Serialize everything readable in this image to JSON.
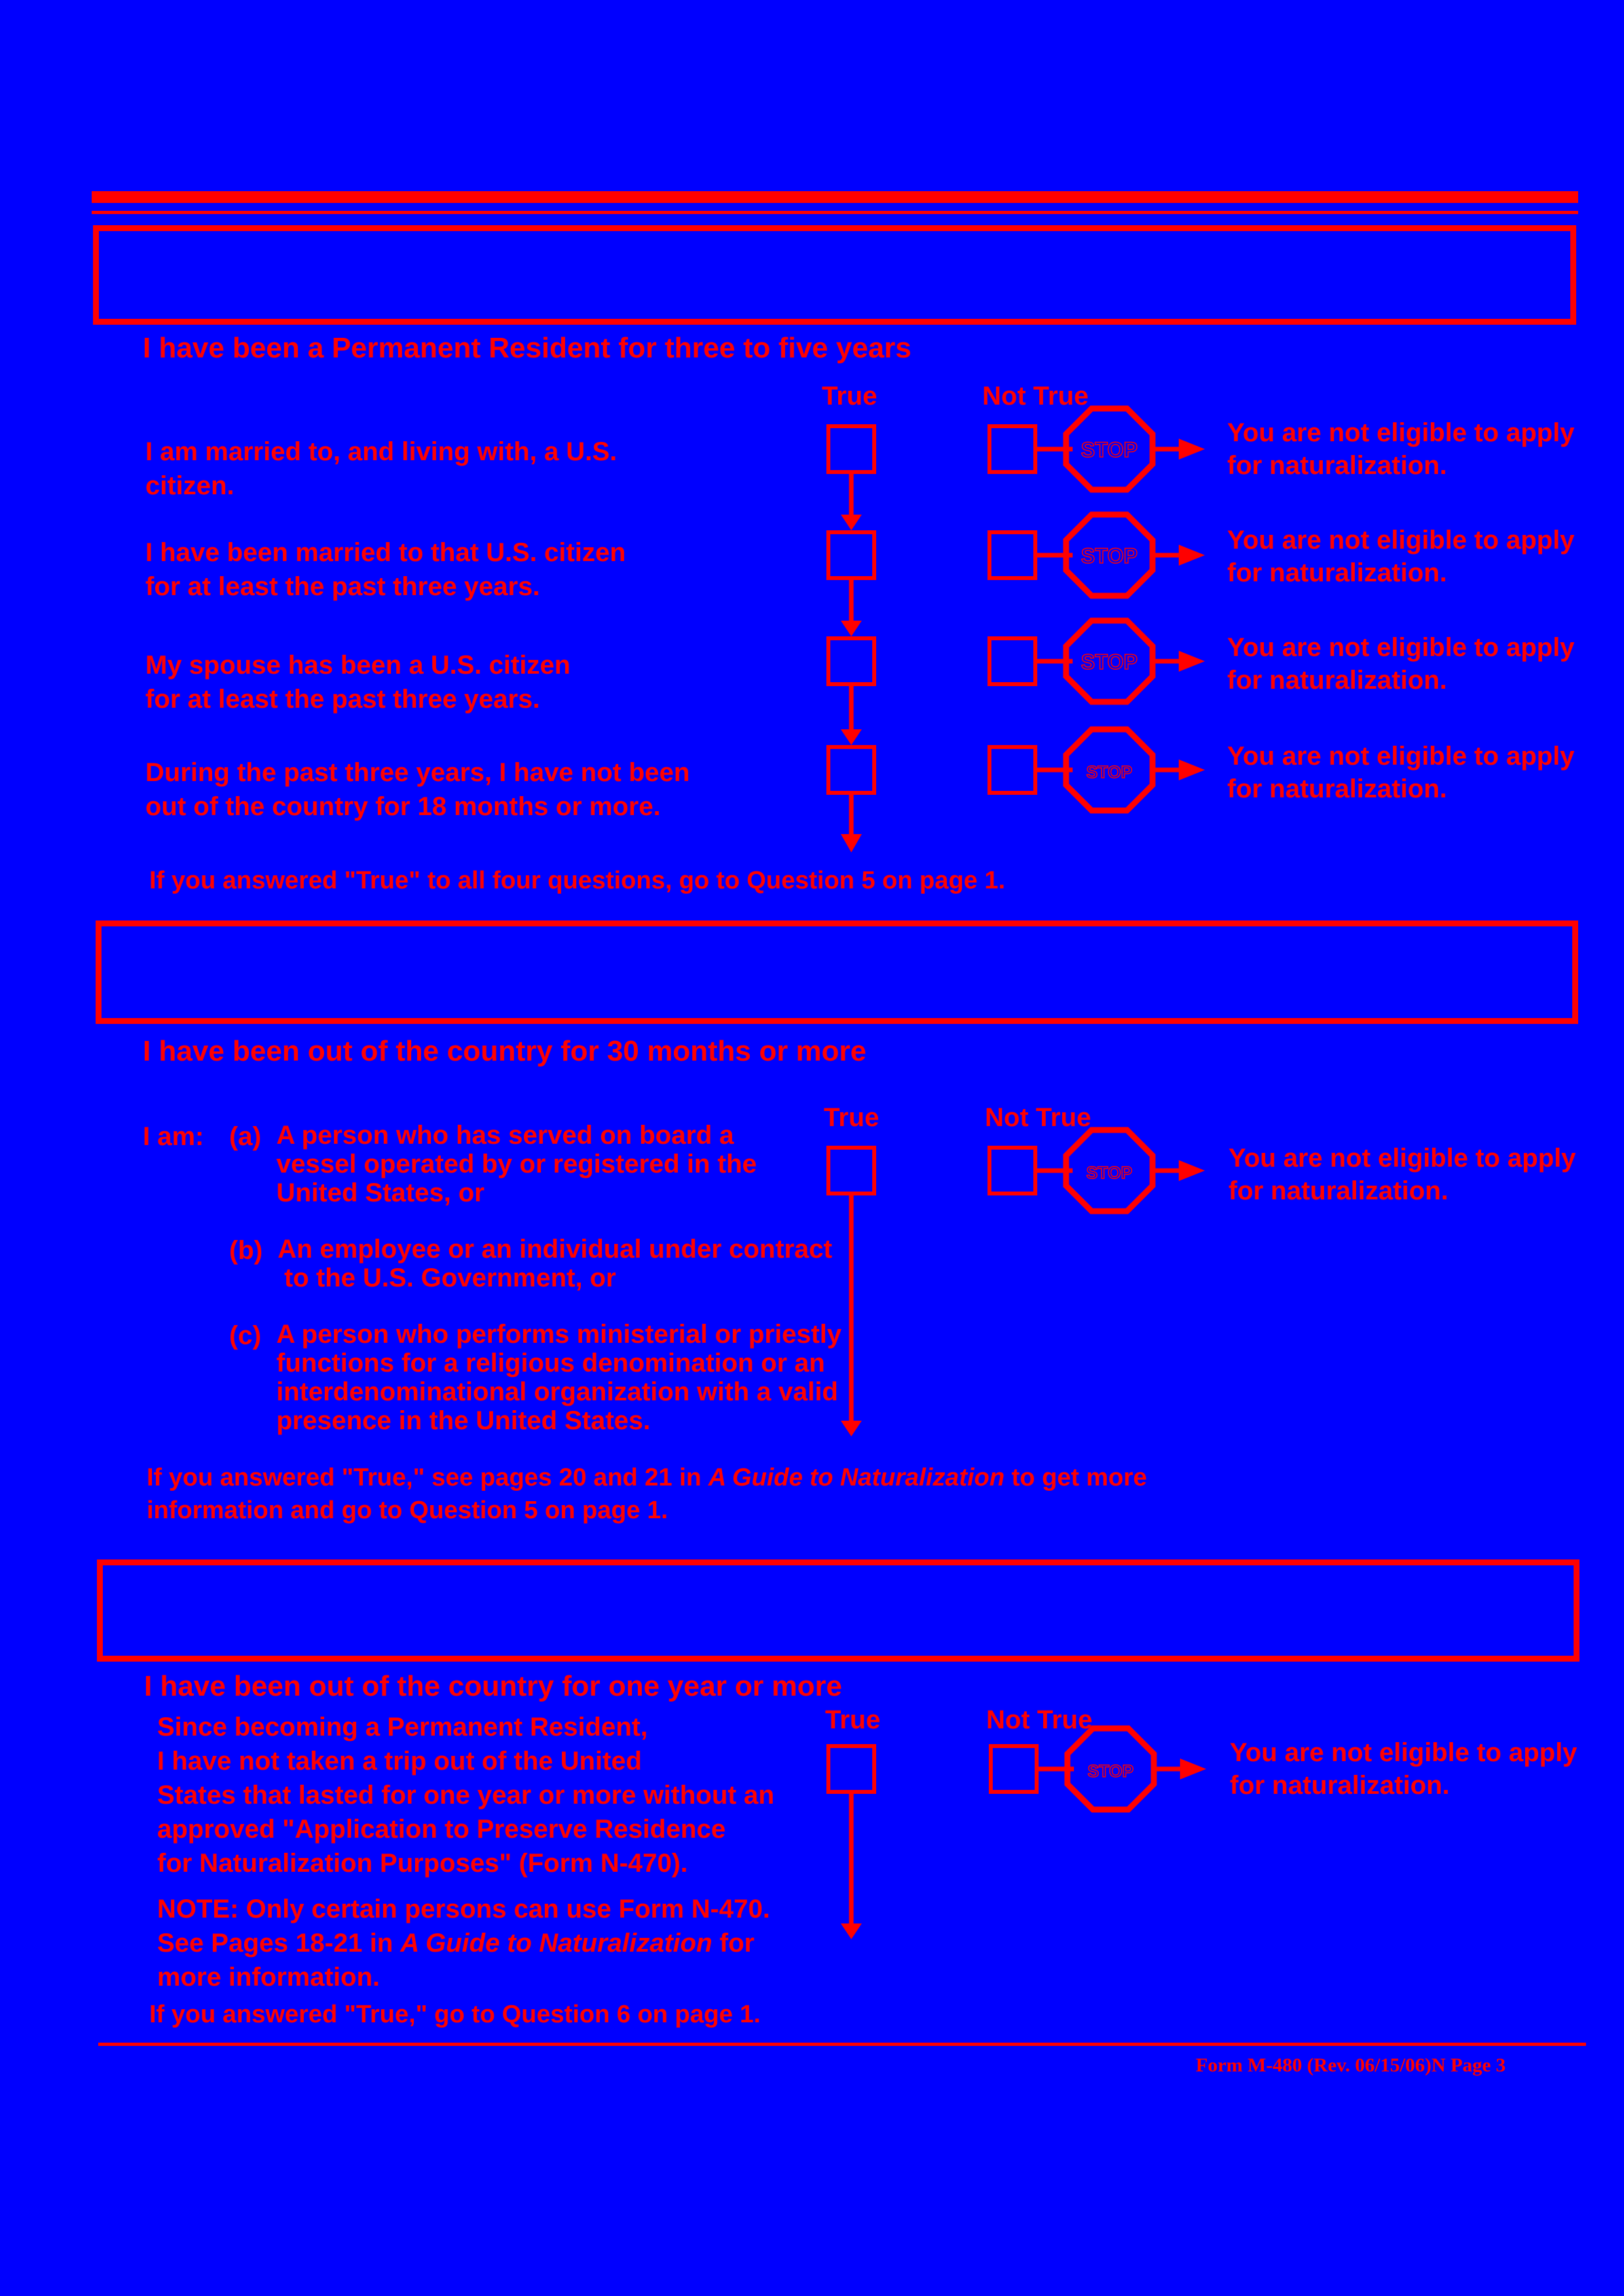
{
  "sections": [
    {
      "banner_text": "",
      "heading": "I have been a Permanent Resident for three to five years",
      "col_true": "True",
      "col_not_true": "Not True",
      "questions": [
        {
          "line1": "I am married to, and living with, a U.S.",
          "line2": "citizen."
        },
        {
          "line1": "I have been married to that U.S. citizen",
          "line2": "for at least the past three years."
        },
        {
          "line1": "My spouse has been a U.S. citizen",
          "line2": "for at least the past three years."
        },
        {
          "line1": "During the past three years, I have not been",
          "line2": "out of the country for 18 months or more."
        }
      ],
      "result_line1": "You are not eligible to apply",
      "result_line2": "for naturalization.",
      "footer": "If you answered \"True\" to all four questions, go to Question 5 on page 1."
    },
    {
      "banner_text": "",
      "heading": "I have been out of the country for 30 months or more",
      "col_true": "True",
      "col_not_true": "Not True",
      "iam": "I am:",
      "options": [
        {
          "label": "(a)",
          "lines": [
            "A person who has served on board a",
            "vessel operated by or registered in the",
            "United States, or"
          ]
        },
        {
          "label": "(b)",
          "lines": [
            "An employee or an individual under contract",
            "to the U.S. Government, or"
          ]
        },
        {
          "label": "(c)",
          "lines": [
            "A person who performs ministerial or priestly",
            "functions for a religious denomination or an",
            "interdenominational organization with a valid",
            "presence in the United States."
          ]
        }
      ],
      "result_line1": "You are not eligible to apply",
      "result_line2": "for naturalization.",
      "footer_pre": "If you answered \"True,\" see pages 20 and 21 in ",
      "footer_italic": "A Guide to Naturalization",
      "footer_post": " to get more",
      "footer_line2": "information and go to Question 5 on page 1."
    },
    {
      "banner_text": "",
      "heading": "I have been out of the country for one year or more",
      "col_true": "True",
      "col_not_true": "Not True",
      "statement_lines": [
        "Since becoming a Permanent Resident,",
        "I have not taken a trip out of the United",
        "States that lasted for one year or more without an",
        "approved \"Application to Preserve Residence",
        "for Naturalization Purposes\" (Form N-470)."
      ],
      "note_label": "NOTE:",
      "note_line1": " Only certain persons can use Form N-470.",
      "note_line2_pre": "See Pages 18-21 in ",
      "note_line2_italic": "A Guide to Naturalization",
      "note_line2_post": " for",
      "note_line3": "more information.",
      "result_line1": "You are not eligible to apply",
      "result_line2": "for naturalization.",
      "footer": "If you answered \"True,\" go to Question 6 on page 1."
    }
  ],
  "stop_sign_label": "STOP",
  "form_number": "Form M-480 (Rev. 06/15/06)N Page 3",
  "colors": {
    "background": "#0000FF",
    "ink": "#FF0000"
  }
}
